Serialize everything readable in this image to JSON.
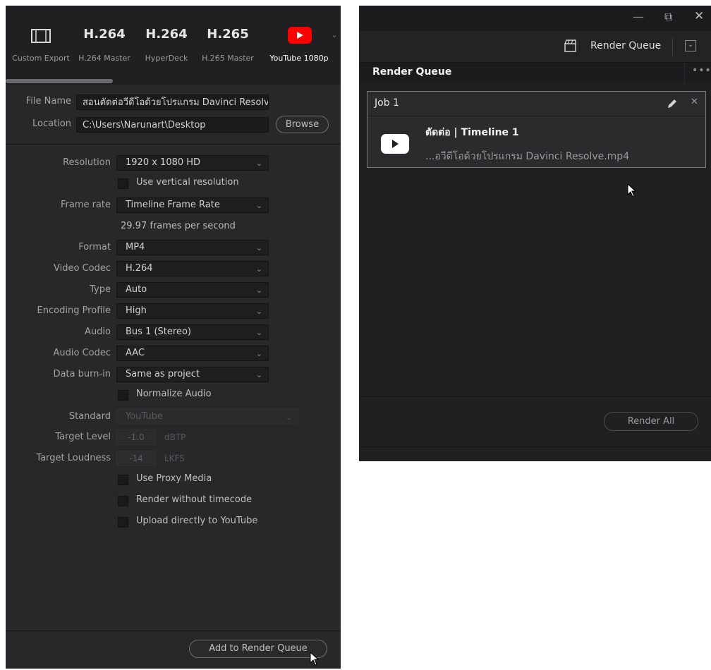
{
  "presets": [
    {
      "label": "Custom Export",
      "big": "",
      "icon": "film-icon"
    },
    {
      "label": "H.264 Master",
      "big": "H.264"
    },
    {
      "label": "HyperDeck",
      "big": "H.264"
    },
    {
      "label": "H.265 Master",
      "big": "H.265"
    },
    {
      "label": "YouTube 1080p",
      "big": "",
      "icon": "youtube-icon",
      "active": true
    }
  ],
  "file": {
    "name_label": "File Name",
    "name_value": "สอนตัดต่อวีดีโอด้วยโปรแกรม Davinci Resolve",
    "location_label": "Location",
    "location_value": "C:\\Users\\Narunart\\Desktop",
    "browse_label": "Browse"
  },
  "settings": {
    "resolution_label": "Resolution",
    "resolution_value": "1920 x 1080 HD",
    "use_vertical_label": "Use vertical resolution",
    "frame_rate_label": "Frame rate",
    "frame_rate_value": "Timeline Frame Rate",
    "fps_note": "29.97 frames per second",
    "format_label": "Format",
    "format_value": "MP4",
    "video_codec_label": "Video Codec",
    "video_codec_value": "H.264",
    "type_label": "Type",
    "type_value": "Auto",
    "encoding_profile_label": "Encoding Profile",
    "encoding_profile_value": "High",
    "audio_label": "Audio",
    "audio_value": "Bus 1 (Stereo)",
    "audio_codec_label": "Audio Codec",
    "audio_codec_value": "AAC",
    "data_burnin_label": "Data burn-in",
    "data_burnin_value": "Same as project",
    "normalize_audio_label": "Normalize Audio",
    "standard_label": "Standard",
    "standard_value": "YouTube",
    "target_level_label": "Target Level",
    "target_level_value": "-1.0",
    "target_level_unit": "dBTP",
    "target_loudness_label": "Target Loudness",
    "target_loudness_value": "-14",
    "target_loudness_unit": "LKFS",
    "use_proxy_label": "Use Proxy Media",
    "render_without_tc_label": "Render without timecode",
    "upload_youtube_label": "Upload directly to YouTube"
  },
  "add_to_queue_label": "Add to Render Queue",
  "render_queue": {
    "toolbar_label": "Render Queue",
    "panel_title": "Render Queue",
    "job_title": "Job 1",
    "job_name": "ตัดต่อ | Timeline 1",
    "job_file": "...อวีดีโอด้วยโปรแกรม Davinci Resolve.mp4",
    "render_all_label": "Render All"
  },
  "window_controls": {
    "minimize": "—",
    "restore": "⧉",
    "close": "✕"
  },
  "colors": {
    "youtube_red": "#ff0000",
    "panel_bg": "#28282b",
    "queue_bg": "#202023"
  }
}
